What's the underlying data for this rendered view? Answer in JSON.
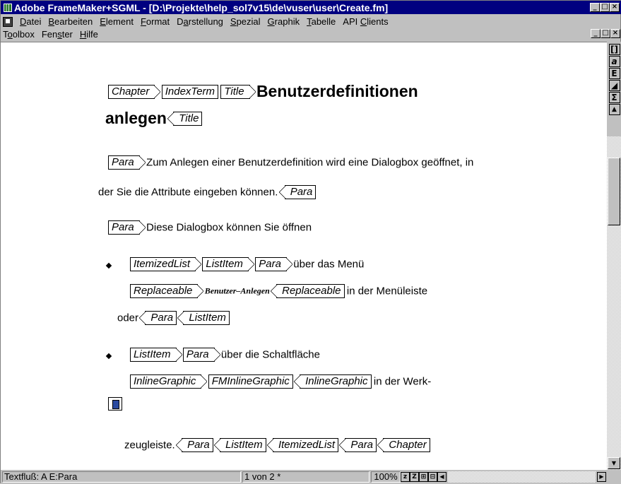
{
  "window": {
    "title": "Adobe FrameMaker+SGML - [D:\\Projekte\\help_sol7v15\\de\\vuser\\user\\Create.fm]",
    "minimize": "_",
    "maximize": "□",
    "close": "×"
  },
  "menu_row1": [
    {
      "pre": "",
      "u": "D",
      "post": "atei"
    },
    {
      "pre": "",
      "u": "B",
      "post": "earbeiten"
    },
    {
      "pre": "",
      "u": "E",
      "post": "lement"
    },
    {
      "pre": "",
      "u": "F",
      "post": "ormat"
    },
    {
      "pre": "D",
      "u": "a",
      "post": "rstellung"
    },
    {
      "pre": "",
      "u": "S",
      "post": "pezial"
    },
    {
      "pre": "",
      "u": "G",
      "post": "raphik"
    },
    {
      "pre": "",
      "u": "T",
      "post": "abelle"
    },
    {
      "pre": "API ",
      "u": "C",
      "post": "lients"
    }
  ],
  "menu_row2": [
    {
      "pre": "T",
      "u": "o",
      "post": "olbox"
    },
    {
      "pre": "Fen",
      "u": "s",
      "post": "ter"
    },
    {
      "pre": "",
      "u": "H",
      "post": "ilfe"
    }
  ],
  "document": {
    "tags": {
      "chapter": "Chapter",
      "indexterm": "IndexTerm",
      "title": "Title",
      "para": "Para",
      "itemizedlist": "ItemizedList",
      "listitem": "ListItem",
      "replaceable": "Replaceable",
      "inlinegraphic": "InlineGraphic",
      "fminlinegraphic": "FMInlineGraphic"
    },
    "heading_part1": "Benutzerdefinitionen",
    "heading_part2": "anlegen",
    "para1_line1": "Zum Anlegen einer Benutzerdefinition wird eine Dialogbox geöffnet, in",
    "para1_line2": "der Sie die Attribute eingeben können.",
    "para2": "Diese Dialogbox können Sie öffnen",
    "item1_text": "über das Menü",
    "replaceable_text": "Benutzer–Anlegen",
    "item1_cont": "in der Menüleiste",
    "item1_or": "oder",
    "item2_text": "über die Schaltfläche",
    "item2_cont": "in der Werk-",
    "item2_end": "zeugleiste."
  },
  "right_toolbar": [
    "[]",
    "a",
    "E",
    "◢",
    "Σ",
    "▲"
  ],
  "statusbar": {
    "flow": "Textfluß: A  E:Para",
    "page": "1 von 2 *",
    "zoom": "100%",
    "zoom_btns": [
      "z",
      "Z",
      "⊞",
      "⊟"
    ]
  }
}
